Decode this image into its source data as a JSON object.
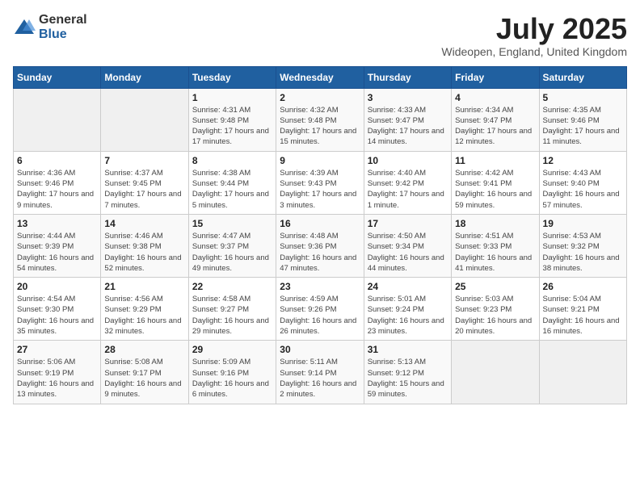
{
  "logo": {
    "general": "General",
    "blue": "Blue"
  },
  "title": "July 2025",
  "location": "Wideopen, England, United Kingdom",
  "days_of_week": [
    "Sunday",
    "Monday",
    "Tuesday",
    "Wednesday",
    "Thursday",
    "Friday",
    "Saturday"
  ],
  "weeks": [
    [
      {
        "day": "",
        "info": ""
      },
      {
        "day": "",
        "info": ""
      },
      {
        "day": "1",
        "info": "Sunrise: 4:31 AM\nSunset: 9:48 PM\nDaylight: 17 hours and 17 minutes."
      },
      {
        "day": "2",
        "info": "Sunrise: 4:32 AM\nSunset: 9:48 PM\nDaylight: 17 hours and 15 minutes."
      },
      {
        "day": "3",
        "info": "Sunrise: 4:33 AM\nSunset: 9:47 PM\nDaylight: 17 hours and 14 minutes."
      },
      {
        "day": "4",
        "info": "Sunrise: 4:34 AM\nSunset: 9:47 PM\nDaylight: 17 hours and 12 minutes."
      },
      {
        "day": "5",
        "info": "Sunrise: 4:35 AM\nSunset: 9:46 PM\nDaylight: 17 hours and 11 minutes."
      }
    ],
    [
      {
        "day": "6",
        "info": "Sunrise: 4:36 AM\nSunset: 9:46 PM\nDaylight: 17 hours and 9 minutes."
      },
      {
        "day": "7",
        "info": "Sunrise: 4:37 AM\nSunset: 9:45 PM\nDaylight: 17 hours and 7 minutes."
      },
      {
        "day": "8",
        "info": "Sunrise: 4:38 AM\nSunset: 9:44 PM\nDaylight: 17 hours and 5 minutes."
      },
      {
        "day": "9",
        "info": "Sunrise: 4:39 AM\nSunset: 9:43 PM\nDaylight: 17 hours and 3 minutes."
      },
      {
        "day": "10",
        "info": "Sunrise: 4:40 AM\nSunset: 9:42 PM\nDaylight: 17 hours and 1 minute."
      },
      {
        "day": "11",
        "info": "Sunrise: 4:42 AM\nSunset: 9:41 PM\nDaylight: 16 hours and 59 minutes."
      },
      {
        "day": "12",
        "info": "Sunrise: 4:43 AM\nSunset: 9:40 PM\nDaylight: 16 hours and 57 minutes."
      }
    ],
    [
      {
        "day": "13",
        "info": "Sunrise: 4:44 AM\nSunset: 9:39 PM\nDaylight: 16 hours and 54 minutes."
      },
      {
        "day": "14",
        "info": "Sunrise: 4:46 AM\nSunset: 9:38 PM\nDaylight: 16 hours and 52 minutes."
      },
      {
        "day": "15",
        "info": "Sunrise: 4:47 AM\nSunset: 9:37 PM\nDaylight: 16 hours and 49 minutes."
      },
      {
        "day": "16",
        "info": "Sunrise: 4:48 AM\nSunset: 9:36 PM\nDaylight: 16 hours and 47 minutes."
      },
      {
        "day": "17",
        "info": "Sunrise: 4:50 AM\nSunset: 9:34 PM\nDaylight: 16 hours and 44 minutes."
      },
      {
        "day": "18",
        "info": "Sunrise: 4:51 AM\nSunset: 9:33 PM\nDaylight: 16 hours and 41 minutes."
      },
      {
        "day": "19",
        "info": "Sunrise: 4:53 AM\nSunset: 9:32 PM\nDaylight: 16 hours and 38 minutes."
      }
    ],
    [
      {
        "day": "20",
        "info": "Sunrise: 4:54 AM\nSunset: 9:30 PM\nDaylight: 16 hours and 35 minutes."
      },
      {
        "day": "21",
        "info": "Sunrise: 4:56 AM\nSunset: 9:29 PM\nDaylight: 16 hours and 32 minutes."
      },
      {
        "day": "22",
        "info": "Sunrise: 4:58 AM\nSunset: 9:27 PM\nDaylight: 16 hours and 29 minutes."
      },
      {
        "day": "23",
        "info": "Sunrise: 4:59 AM\nSunset: 9:26 PM\nDaylight: 16 hours and 26 minutes."
      },
      {
        "day": "24",
        "info": "Sunrise: 5:01 AM\nSunset: 9:24 PM\nDaylight: 16 hours and 23 minutes."
      },
      {
        "day": "25",
        "info": "Sunrise: 5:03 AM\nSunset: 9:23 PM\nDaylight: 16 hours and 20 minutes."
      },
      {
        "day": "26",
        "info": "Sunrise: 5:04 AM\nSunset: 9:21 PM\nDaylight: 16 hours and 16 minutes."
      }
    ],
    [
      {
        "day": "27",
        "info": "Sunrise: 5:06 AM\nSunset: 9:19 PM\nDaylight: 16 hours and 13 minutes."
      },
      {
        "day": "28",
        "info": "Sunrise: 5:08 AM\nSunset: 9:17 PM\nDaylight: 16 hours and 9 minutes."
      },
      {
        "day": "29",
        "info": "Sunrise: 5:09 AM\nSunset: 9:16 PM\nDaylight: 16 hours and 6 minutes."
      },
      {
        "day": "30",
        "info": "Sunrise: 5:11 AM\nSunset: 9:14 PM\nDaylight: 16 hours and 2 minutes."
      },
      {
        "day": "31",
        "info": "Sunrise: 5:13 AM\nSunset: 9:12 PM\nDaylight: 15 hours and 59 minutes."
      },
      {
        "day": "",
        "info": ""
      },
      {
        "day": "",
        "info": ""
      }
    ]
  ]
}
